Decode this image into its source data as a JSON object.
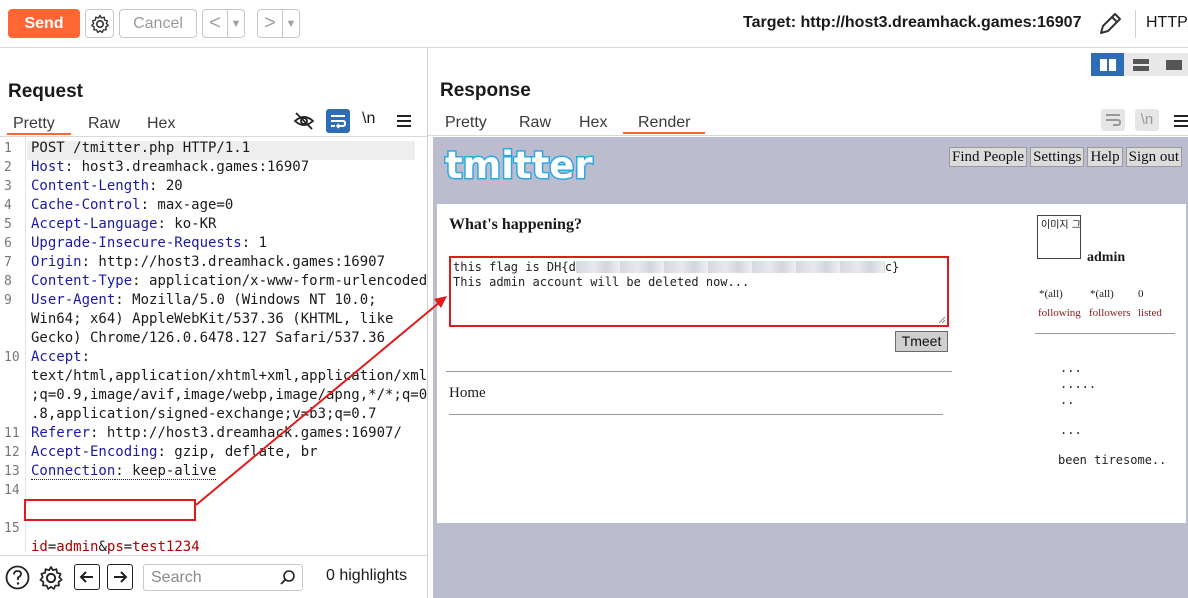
{
  "toolbar": {
    "send_label": "Send",
    "cancel_label": "Cancel",
    "back_label": "<",
    "forward_label": ">",
    "target_label": "Target: http://host3.dreamhack.games:16907",
    "protocol_label": "HTTP/"
  },
  "request": {
    "title": "Request",
    "tabs": [
      "Pretty",
      "Raw",
      "Hex"
    ],
    "newline_label": "\\n",
    "lines": [
      {
        "n": "1",
        "text": "POST /tmitter.php HTTP/1.1"
      },
      {
        "n": "2",
        "key": "Host",
        "value": ": host3.dreamhack.games:16907"
      },
      {
        "n": "3",
        "key": "Content-Length",
        "value": ": 20"
      },
      {
        "n": "4",
        "key": "Cache-Control",
        "value": ": max-age=0"
      },
      {
        "n": "5",
        "key": "Accept-Language",
        "value": ": ko-KR"
      },
      {
        "n": "6",
        "key": "Upgrade-Insecure-Requests",
        "value": ": 1"
      },
      {
        "n": "7",
        "key": "Origin",
        "value": ": http://host3.dreamhack.games:16907"
      },
      {
        "n": "8",
        "key": "Content-Type",
        "value": ": application/x-www-form-urlencoded"
      },
      {
        "n": "9",
        "key": "User-Agent",
        "value": ": Mozilla/5.0 (Windows NT 10.0;"
      },
      {
        "n": "",
        "text": "Win64; x64) AppleWebKit/537.36 (KHTML, like"
      },
      {
        "n": "",
        "text": "Gecko) Chrome/126.0.6478.127 Safari/537.36"
      },
      {
        "n": "10",
        "key": "Accept",
        "value": ":"
      },
      {
        "n": "",
        "text": "text/html,application/xhtml+xml,application/xml"
      },
      {
        "n": "",
        "text": ";q=0.9,image/avif,image/webp,image/apng,*/*;q=0"
      },
      {
        "n": "",
        "text": ".8,application/signed-exchange;v=b3;q=0.7"
      },
      {
        "n": "11",
        "key": "Referer",
        "value": ": http://host3.dreamhack.games:16907/"
      },
      {
        "n": "12",
        "key": "Accept-Encoding",
        "value": ": gzip, deflate, br"
      },
      {
        "n": "13",
        "key": "Connection",
        "value": ": keep-alive"
      },
      {
        "n": "14",
        "text": ""
      },
      {
        "n": "15",
        "text": ""
      }
    ],
    "body": {
      "k1": "id",
      "v1": "admin",
      "amp": "&",
      "k2": "ps",
      "v2": "test1234",
      "eq": "="
    },
    "search_placeholder": "Search",
    "highlights": "0 highlights"
  },
  "response": {
    "title": "Response",
    "tabs": [
      "Pretty",
      "Raw",
      "Hex",
      "Render"
    ],
    "newline_label": "\\n",
    "page": {
      "logo": "tmitter",
      "nav": [
        "Find People",
        "Settings",
        "Help",
        "Sign out"
      ],
      "whats_happening": "What's happening?",
      "tweet_line1_prefix": "this flag is DH{d",
      "tweet_line1_suffix": "c}",
      "tweet_line2": "This admin account will be deleted now...",
      "tmeet_button": "Tmeet",
      "home": "Home",
      "avatar_text": "이미지 그런거 없다.",
      "username": "admin",
      "stats_counts": [
        "*(all)",
        "*(all)",
        "0"
      ],
      "stats_labels": [
        "following",
        "followers",
        "listed"
      ],
      "side_lines": [
        "...",
        ".....",
        "..",
        "...",
        "been tiresome.."
      ]
    }
  }
}
